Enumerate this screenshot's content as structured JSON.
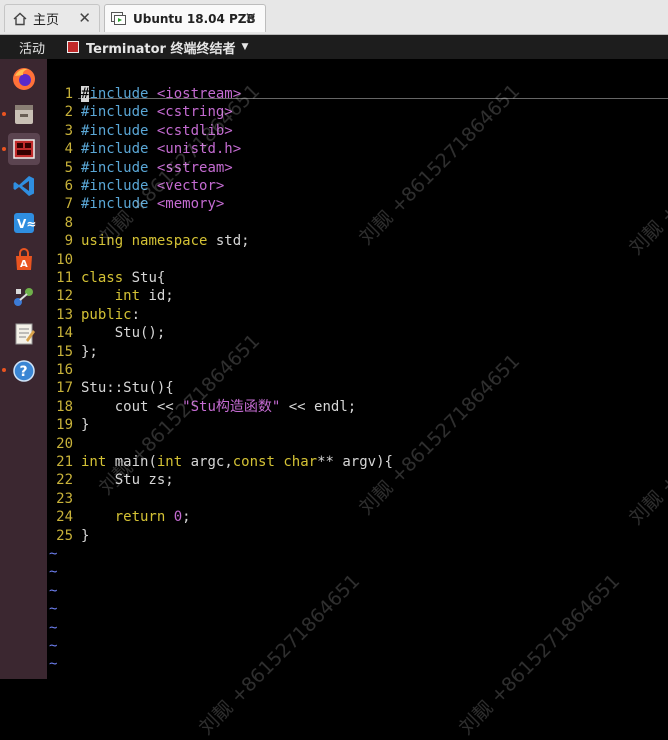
{
  "tabs": [
    {
      "label": "主页",
      "icon": "home-icon"
    },
    {
      "label": "Ubuntu 18.04 PZB",
      "icon": "vm-icon"
    }
  ],
  "panel": {
    "activities": "活动",
    "app_name": "Terminator 终端终结者"
  },
  "dock": [
    {
      "name": "firefox-icon",
      "color": "#ff7139"
    },
    {
      "name": "files-icon",
      "color": "#c9c0b5"
    },
    {
      "name": "terminator-icon",
      "color": "#c02a2a"
    },
    {
      "name": "vscode-icon",
      "color": "#2f8ee0"
    },
    {
      "name": "vm-app-icon",
      "color": "#2f8ee0"
    },
    {
      "name": "software-center-icon",
      "color": "#e95420"
    },
    {
      "name": "network-tool-icon",
      "color": "#3c7bd6"
    },
    {
      "name": "text-editor-icon",
      "color": "#f4f1e8"
    },
    {
      "name": "help-icon",
      "color": "#3a86d4"
    }
  ],
  "code_lines": [
    "#include <iostream>",
    "#include <cstring>",
    "#include <cstdlib>",
    "#include <unistd.h>",
    "#include <sstream>",
    "#include <vector>",
    "#include <memory>",
    "",
    "using namespace std;",
    "",
    "class Stu{",
    "    int id;",
    "public:",
    "    Stu();",
    "};",
    "",
    "Stu::Stu(){",
    "    cout << \"Stu构造函数\" << endl;",
    "}",
    "",
    "int main(int argc,const char** argv){",
    "    Stu zs;",
    "",
    "    return 0;",
    "}"
  ],
  "line_numbers": [
    "1",
    "2",
    "3",
    "4",
    "5",
    "6",
    "7",
    "8",
    "9",
    "10",
    "11",
    "12",
    "13",
    "14",
    "15",
    "16",
    "17",
    "18",
    "19",
    "20",
    "21",
    "22",
    "23",
    "24",
    "25"
  ],
  "empty_marker": "~",
  "watermark": "刘靓 +8615271864651"
}
